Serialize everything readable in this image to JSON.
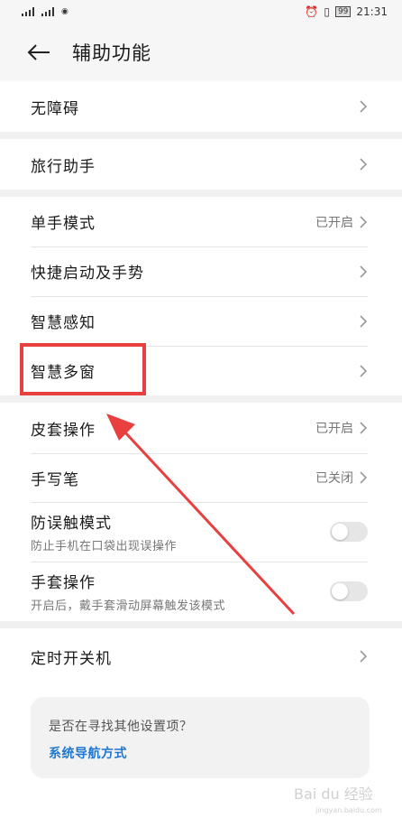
{
  "status_bar": {
    "time": "21:31",
    "battery": "99"
  },
  "header": {
    "title": "辅助功能"
  },
  "settings": [
    {
      "label": "无障碍"
    },
    {
      "label": "旅行助手"
    },
    {
      "label": "单手模式",
      "value": "已开启"
    },
    {
      "label": "快捷启动及手势"
    },
    {
      "label": "智慧感知"
    },
    {
      "label": "智慧多窗"
    },
    {
      "label": "皮套操作",
      "value": "已开启"
    },
    {
      "label": "手写笔",
      "value": "已关闭"
    },
    {
      "label": "防误触模式",
      "sub": "防止手机在口袋出现误操作",
      "toggle": false
    },
    {
      "label": "手套操作",
      "sub": "开启后，戴手套滑动屏幕触发该模式",
      "toggle": false
    },
    {
      "label": "定时开关机"
    }
  ],
  "suggestion": {
    "question": "是否在寻找其他设置项？",
    "link": "系统导航方式"
  },
  "watermark": {
    "text": "Bai du 经验",
    "sub": "jingyan.baidu.com"
  },
  "colors": {
    "highlight": "#e8403f",
    "link": "#1f78d1",
    "background": "#f0f0f0"
  }
}
